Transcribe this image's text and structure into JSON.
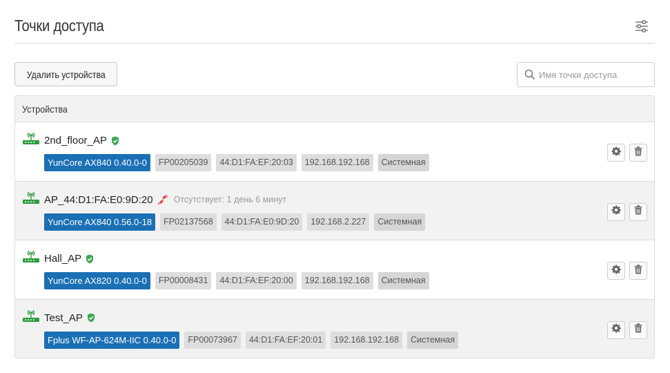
{
  "page": {
    "title": "Точки доступа",
    "settings_icon": "sliders-icon"
  },
  "toolbar": {
    "delete_label": "Удалить устройства",
    "search_placeholder": "Имя точки доступа",
    "search_value": ""
  },
  "panel": {
    "header": "Устройства"
  },
  "colors": {
    "model_chip": "#1a6fb5",
    "chip_bg": "#dedede",
    "status_ok": "#3aa655",
    "status_disconnected": "#e8455a",
    "ap_icon": "#2e9b3e"
  },
  "devices": [
    {
      "name": "2nd_floor_AP",
      "status": "online",
      "status_icon": "shield-check-icon",
      "absent_text": "",
      "model": "YunCore AX840 0.40.0-0",
      "serial": "FP00205039",
      "mac": "44:D1:FA:EF:20:03",
      "ip": "192.168.192.168",
      "profile": "Системная"
    },
    {
      "name": "AP_44:D1:FA:E0:9D:20",
      "status": "offline",
      "status_icon": "unplugged-icon",
      "absent_text": "Отсутствует: 1 день 6 минут",
      "model": "YunCore AX840 0.56.0-18",
      "serial": "FP02137568",
      "mac": "44:D1:FA:E0:9D:20",
      "ip": "192.168.2.227",
      "profile": "Системная"
    },
    {
      "name": "Hall_AP",
      "status": "online",
      "status_icon": "shield-check-icon",
      "absent_text": "",
      "model": "YunCore AX820 0.40.0-0",
      "serial": "FP00008431",
      "mac": "44:D1:FA:EF:20:00",
      "ip": "192.168.192.168",
      "profile": "Системная"
    },
    {
      "name": "Test_AP",
      "status": "online",
      "status_icon": "shield-check-icon",
      "absent_text": "",
      "model": "Fplus WF-AP-624M-IIC 0.40.0-0",
      "serial": "FP00073967",
      "mac": "44:D1:FA:EF:20:01",
      "ip": "192.168.192.168",
      "profile": "Системная"
    }
  ]
}
